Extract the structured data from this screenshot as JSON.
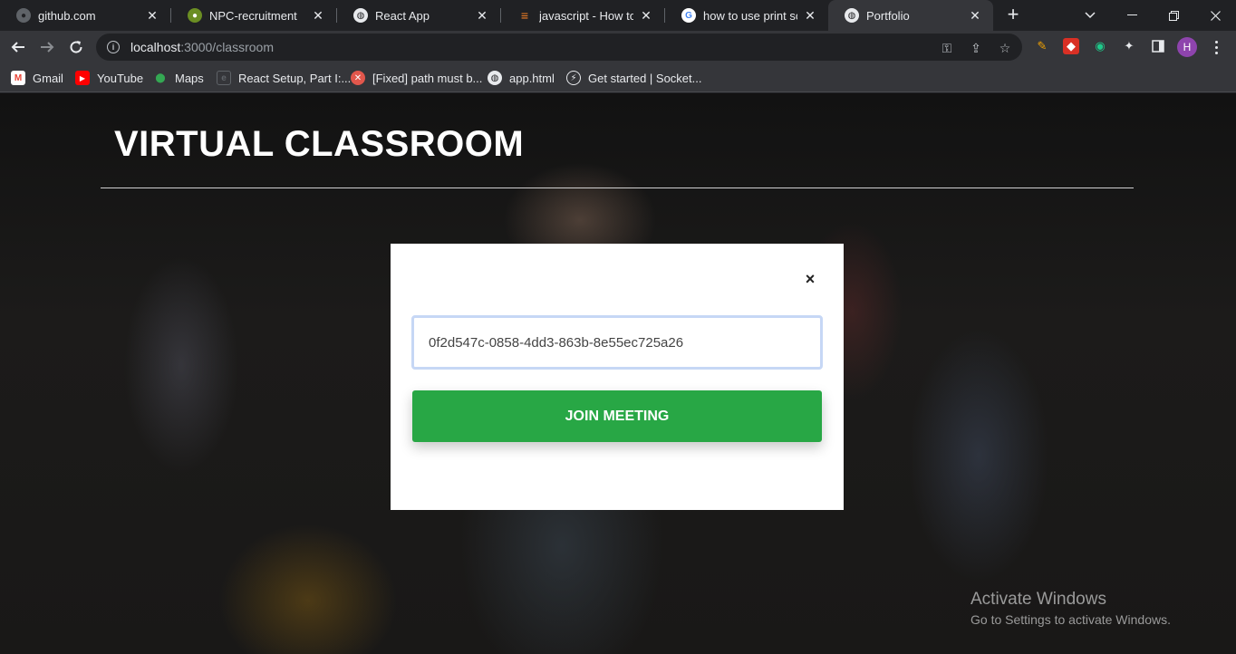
{
  "browser": {
    "tabs": [
      {
        "title": "github.com",
        "icon": "github-icon"
      },
      {
        "title": "NPC-recruitment",
        "icon": "npc-icon"
      },
      {
        "title": "React App",
        "icon": "globe-icon"
      },
      {
        "title": "javascript - How to se",
        "icon": "stackoverflow-icon"
      },
      {
        "title": "how to use print scree",
        "icon": "google-icon"
      },
      {
        "title": "Portfolio",
        "icon": "globe-icon",
        "active": true
      }
    ],
    "new_tab_label": "+",
    "address": {
      "host": "localhost",
      "path": ":3000/classroom"
    },
    "profile_initial": "H",
    "bookmarks": [
      {
        "label": "Gmail",
        "icon": "gmail-icon"
      },
      {
        "label": "YouTube",
        "icon": "youtube-icon"
      },
      {
        "label": "Maps",
        "icon": "maps-icon"
      },
      {
        "label": "React Setup, Part I:...",
        "icon": "doc-icon"
      },
      {
        "label": "[Fixed] path must b...",
        "icon": "error-icon"
      },
      {
        "label": "app.html",
        "icon": "globe-icon"
      },
      {
        "label": "Get started | Socket...",
        "icon": "socketio-icon"
      }
    ]
  },
  "page": {
    "title": "VIRTUAL CLASSROOM",
    "modal": {
      "close_symbol": "×",
      "meeting_id": "0f2d547c-0858-4dd3-863b-8e55ec725a26",
      "join_label": "JOIN MEETING"
    }
  },
  "watermark": {
    "line1": "Activate Windows",
    "line2": "Go to Settings to activate Windows."
  },
  "colors": {
    "join_button": "#28a745",
    "chrome_dark": "#202124",
    "chrome_toolbar": "#35363a"
  }
}
